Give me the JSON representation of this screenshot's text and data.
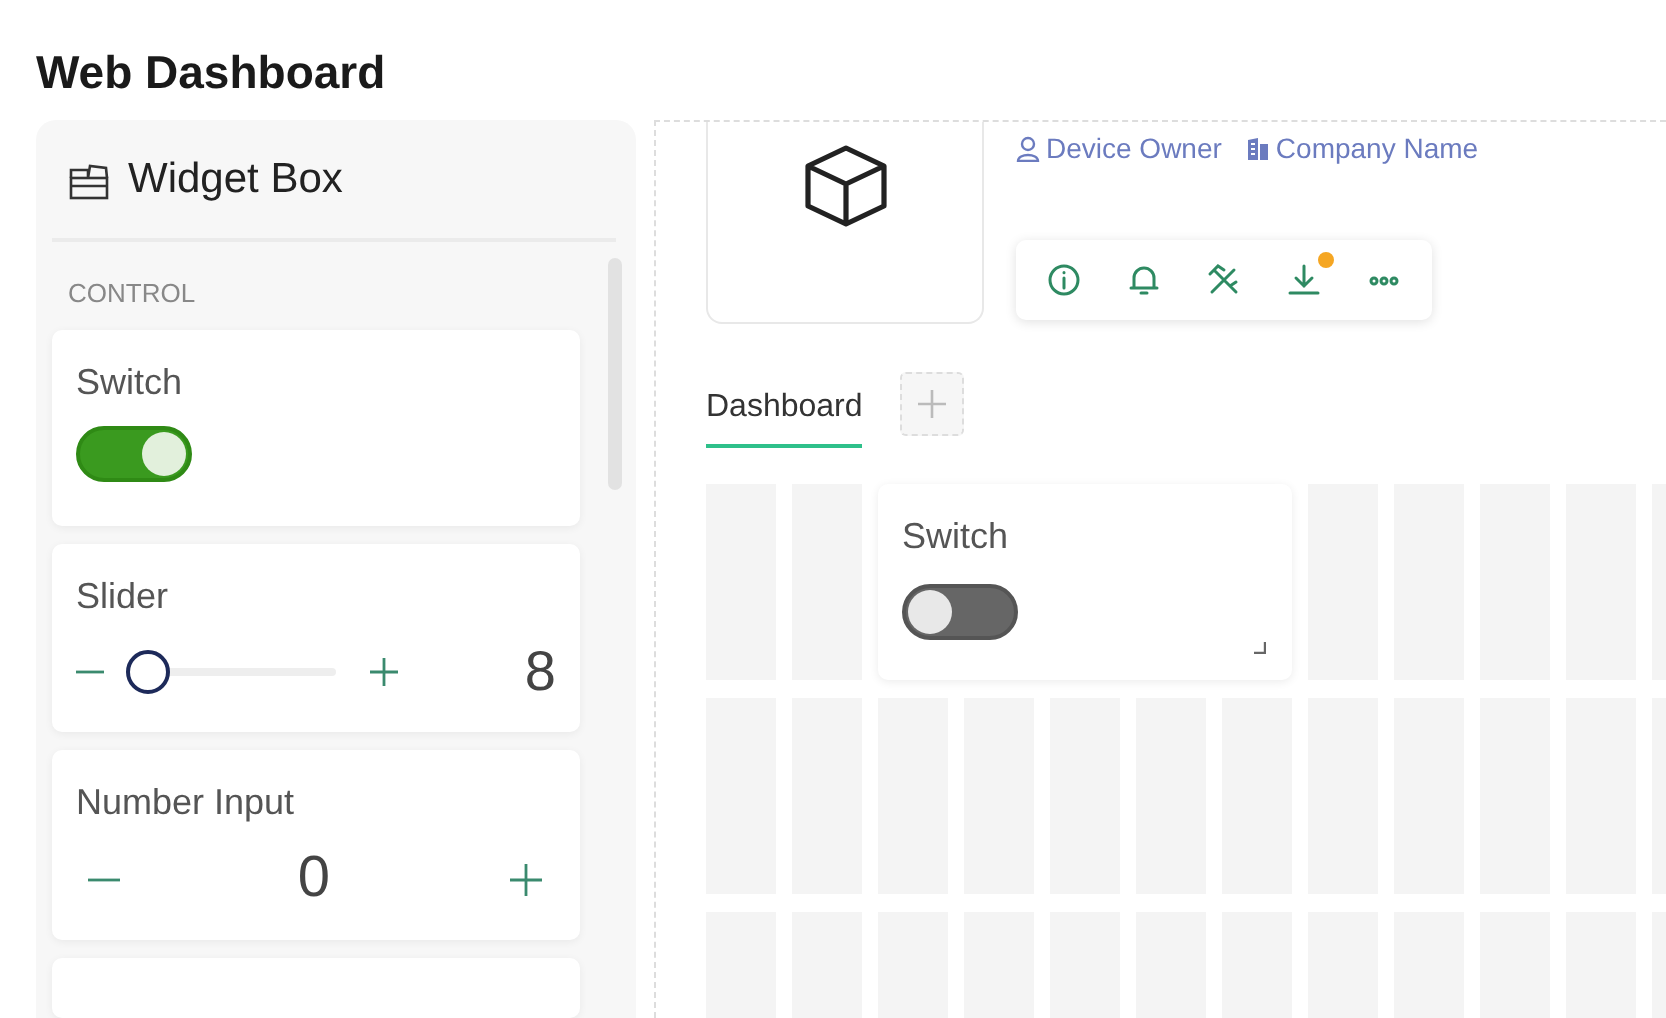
{
  "title": "Web Dashboard",
  "widget_box": {
    "title": "Widget Box",
    "section": "CONTROL",
    "widgets": [
      {
        "kind": "switch",
        "label": "Switch",
        "on": true
      },
      {
        "kind": "slider",
        "label": "Slider",
        "level": 0.1,
        "value": "8"
      },
      {
        "kind": "number",
        "label": "Number Input",
        "value": "0"
      }
    ]
  },
  "device": {
    "owner": "Device Owner",
    "company": "Company Name",
    "toolbar": [
      {
        "kind": "info",
        "badge": false
      },
      {
        "kind": "bell",
        "badge": false
      },
      {
        "kind": "tools",
        "badge": false
      },
      {
        "kind": "download",
        "badge": true
      },
      {
        "kind": "more",
        "badge": false
      }
    ]
  },
  "tabs": [
    {
      "label": "Dashboard",
      "selected": true
    }
  ],
  "canvas_widgets": [
    {
      "label": "Switch",
      "on": false
    }
  ]
}
